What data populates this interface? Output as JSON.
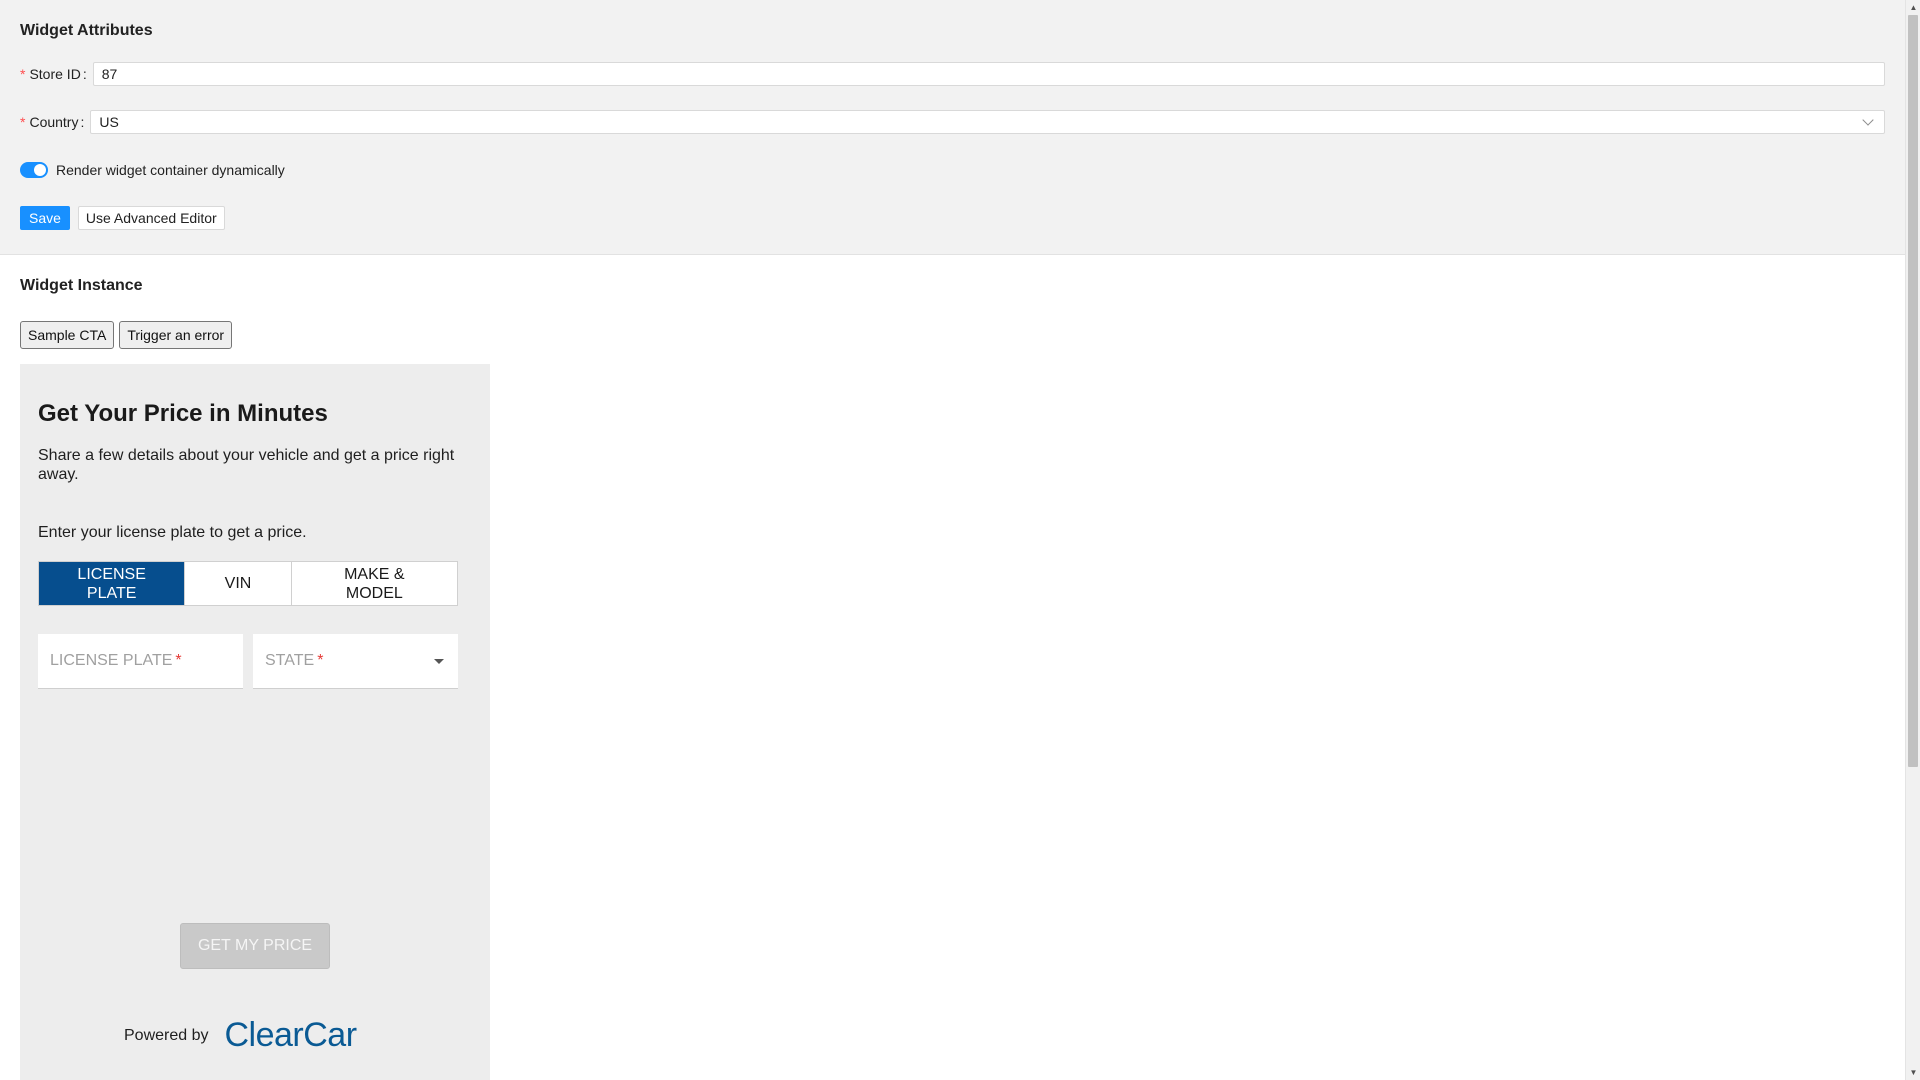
{
  "attributes": {
    "title": "Widget Attributes",
    "store_id_label": "Store ID",
    "store_id_value": "87",
    "country_label": "Country",
    "country_value": "US",
    "toggle_label": "Render widget container dynamically",
    "toggle_on": true,
    "save_label": "Save",
    "advanced_label": "Use Advanced Editor"
  },
  "instance": {
    "title": "Widget Instance",
    "sample_cta_label": "Sample CTA",
    "trigger_error_label": "Trigger an error"
  },
  "widget": {
    "title": "Get Your Price in Minutes",
    "description": "Share a few details about your vehicle and get a price right away.",
    "prompt": "Enter your license plate to get a price.",
    "tabs": [
      {
        "label": "LICENSE PLATE",
        "active": true
      },
      {
        "label": "VIN",
        "active": false
      },
      {
        "label": "MAKE & MODEL",
        "active": false
      }
    ],
    "plate_placeholder": "LICENSE PLATE",
    "state_placeholder": "STATE",
    "required_mark": "*",
    "submit_label": "GET MY PRICE",
    "powered_by": "Powered by",
    "logo_text": "ClearCar"
  },
  "colors": {
    "accent": "#1890ff",
    "tab_active": "#064e8e",
    "logo": "#0a5a94",
    "required": "#ff4d4f"
  }
}
